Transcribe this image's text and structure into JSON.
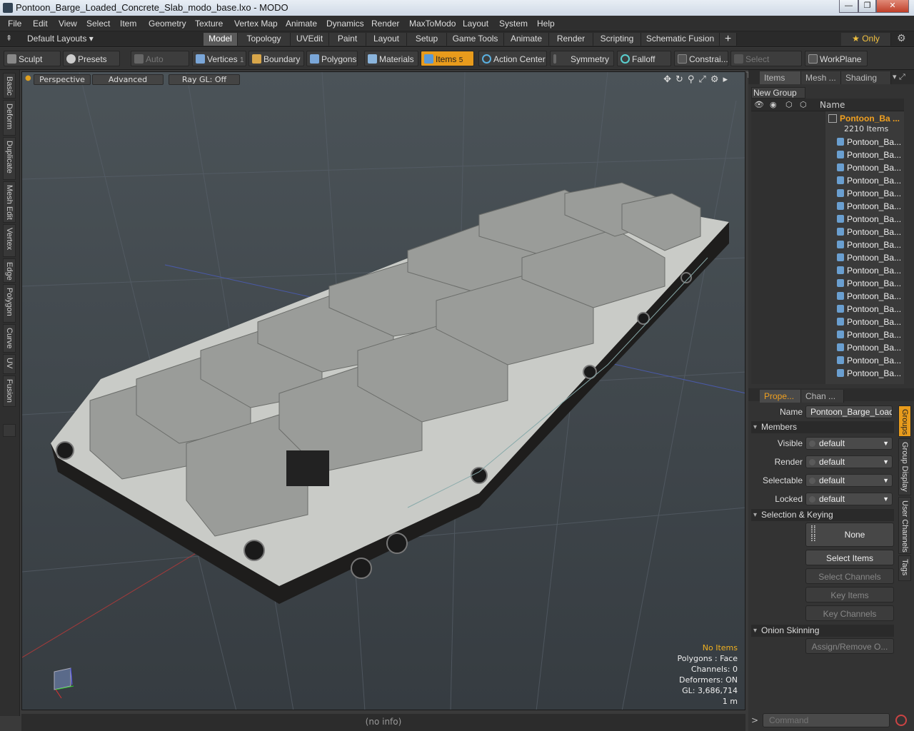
{
  "window": {
    "title": "Pontoon_Barge_Loaded_Concrete_Slab_modo_base.lxo - MODO",
    "min": "—",
    "max": "❐",
    "close": "✕"
  },
  "menu": [
    "File",
    "Edit",
    "View",
    "Select",
    "Item",
    "Geometry",
    "Texture",
    "Vertex Map",
    "Animate",
    "Dynamics",
    "Render",
    "MaxToModo",
    "Layout",
    "System",
    "Help"
  ],
  "layout_selector": "Default Layouts ▾",
  "tabs": [
    "Model",
    "Topology",
    "UVEdit",
    "Paint",
    "Layout",
    "Setup",
    "Game Tools",
    "Animate",
    "Render",
    "Scripting",
    "Schematic Fusion"
  ],
  "tabs_add": "+",
  "only_label": "★ Only",
  "toolbar": {
    "sculpt": "Sculpt",
    "presets": "Presets",
    "auto_select": "Auto Select",
    "vertices": "Vertices",
    "vertices_count": "1",
    "boundary": "Boundary",
    "polygons": "Polygons",
    "materials": "Materials",
    "items": "Items",
    "items_count": "5",
    "action_center": "Action Center",
    "symmetry": "Symmetry",
    "falloff": "Falloff",
    "constrain": "Constrai...",
    "select_through": "Select Through",
    "workplane": "WorkPlane"
  },
  "left_tabs": [
    "Basic",
    "Deform",
    "Duplicate",
    "Mesh Edit",
    "Vertex",
    "Edge",
    "Polygon",
    "Curve",
    "UV",
    "Fusion"
  ],
  "viewport": {
    "view": "Perspective",
    "advanced": "Advanced",
    "raygl": "Ray GL: Off",
    "stats": {
      "no_items": "No Items",
      "polygons": "Polygons : Face",
      "channels": "Channels: 0",
      "deformers": "Deformers: ON",
      "gl": "GL: 3,686,714",
      "scale": "1 m"
    }
  },
  "status": "(no info)",
  "right_tabs": [
    "Items",
    "Mesh ...",
    "Shading"
  ],
  "new_group": "New Group",
  "name_header": "Name",
  "root_item": {
    "name": "Pontoon_Ba ...",
    "count": "2210 Items"
  },
  "children": [
    "Pontoon_Ba...",
    "Pontoon_Ba...",
    "Pontoon_Ba...",
    "Pontoon_Ba...",
    "Pontoon_Ba...",
    "Pontoon_Ba...",
    "Pontoon_Ba...",
    "Pontoon_Ba...",
    "Pontoon_Ba...",
    "Pontoon_Ba...",
    "Pontoon_Ba...",
    "Pontoon_Ba...",
    "Pontoon_Ba...",
    "Pontoon_Ba...",
    "Pontoon_Ba...",
    "Pontoon_Ba...",
    "Pontoon_Ba...",
    "Pontoon_Ba...",
    "Pontoon_Ba..."
  ],
  "props": {
    "tab1": "Prope...",
    "tab2": "Chan ...",
    "name_label": "Name",
    "name_value": "Pontoon_Barge_Loaded",
    "members": "Members",
    "visible_label": "Visible",
    "render_label": "Render",
    "selectable_label": "Selectable",
    "locked_label": "Locked",
    "default": "default",
    "selection_keying": "Selection & Keying",
    "none": "None",
    "select_items": "Select Items",
    "select_channels": "Select Channels",
    "key_items": "Key Items",
    "key_channels": "Key Channels",
    "onion": "Onion Skinning",
    "assign": "Assign/Remove O..."
  },
  "side_tabs": [
    "Groups",
    "Group Display",
    "User Channels",
    "Tags"
  ],
  "command_placeholder": "Command",
  "colors": {
    "accent": "#e89b1c",
    "item_orange": "#f0a020"
  }
}
